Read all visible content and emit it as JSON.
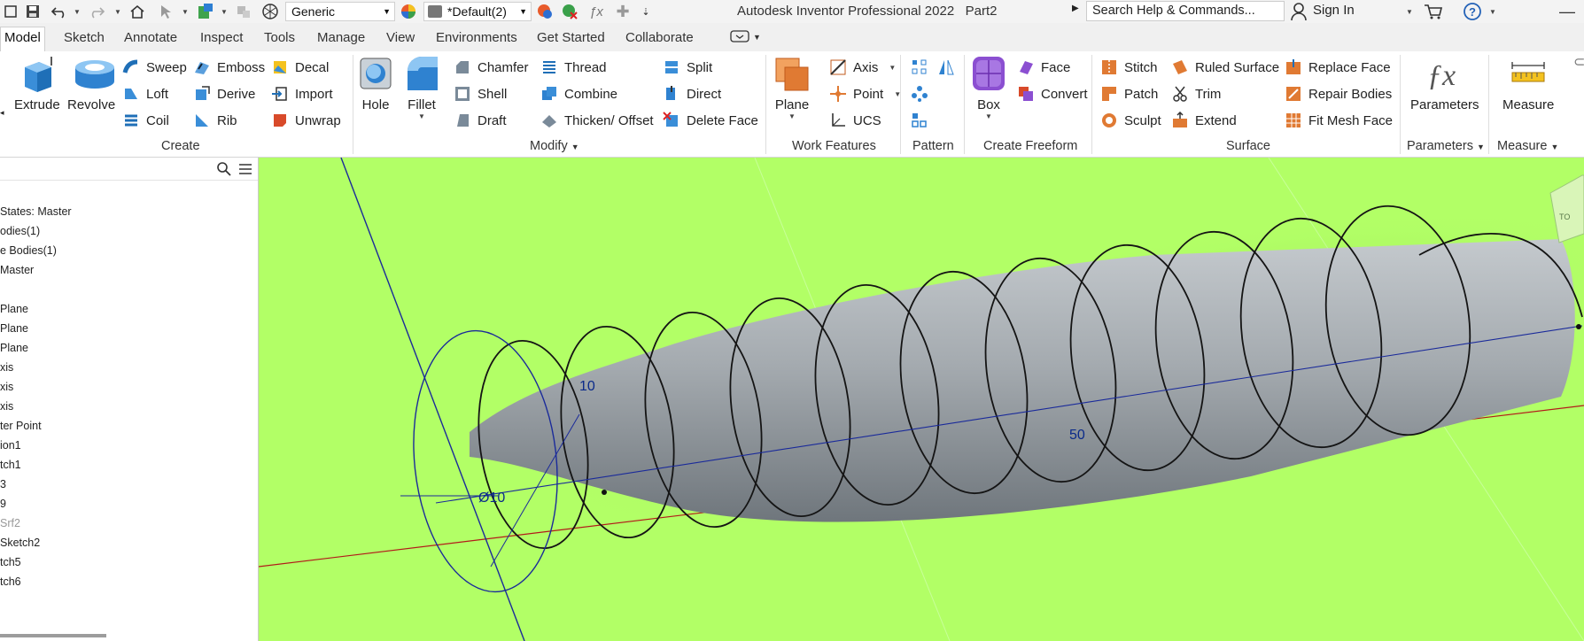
{
  "title_bar": {
    "material": "Generic",
    "appearance": "*Default(2)",
    "app_title": "Autodesk Inventor Professional 2022",
    "document": "Part2",
    "search_placeholder": "Search Help & Commands...",
    "sign_in": "Sign In"
  },
  "tabs": [
    "Model",
    "Sketch",
    "Annotate",
    "Inspect",
    "Tools",
    "Manage",
    "View",
    "Environments",
    "Get Started",
    "Collaborate"
  ],
  "ribbon": {
    "create": {
      "label": "Create",
      "extrude": "Extrude",
      "revolve": "Revolve",
      "sweep": "Sweep",
      "loft": "Loft",
      "coil": "Coil",
      "emboss": "Emboss",
      "derive": "Derive",
      "rib": "Rib",
      "decal": "Decal",
      "import": "Import",
      "unwrap": "Unwrap"
    },
    "modify": {
      "label": "Modify",
      "hole": "Hole",
      "fillet": "Fillet",
      "chamfer": "Chamfer",
      "shell": "Shell",
      "draft": "Draft",
      "thread": "Thread",
      "combine": "Combine",
      "thicken": "Thicken/ Offset",
      "split": "Split",
      "direct": "Direct",
      "delete_face": "Delete Face"
    },
    "work_features": {
      "label": "Work Features",
      "plane": "Plane",
      "axis": "Axis",
      "point": "Point",
      "ucs": "UCS"
    },
    "pattern": {
      "label": "Pattern"
    },
    "create_freeform": {
      "label": "Create Freeform",
      "box": "Box",
      "face": "Face",
      "convert": "Convert"
    },
    "surface": {
      "label": "Surface",
      "stitch": "Stitch",
      "patch": "Patch",
      "sculpt": "Sculpt",
      "ruled_surface": "Ruled Surface",
      "trim": "Trim",
      "extend": "Extend",
      "replace_face": "Replace Face",
      "repair_bodies": "Repair Bodies",
      "fit_mesh_face": "Fit Mesh Face"
    },
    "parameters": {
      "label": "Parameters",
      "button": "Parameters"
    },
    "measure": {
      "label": "Measure",
      "button": "Measure"
    }
  },
  "browser": {
    "items": [
      "States: Master",
      "odies(1)",
      "e Bodies(1)",
      "Master",
      "Plane",
      "Plane",
      "Plane",
      "xis",
      "xis",
      "xis",
      "ter Point",
      "ion1",
      "tch1",
      "3",
      "9",
      "Srf2",
      "Sketch2",
      "tch5",
      "tch6"
    ]
  },
  "viewport": {
    "background": "#b2ff66",
    "dim_pitch": "10",
    "dim_diameter": "Ø10",
    "dim_length": "50",
    "view_cube_label": "TO"
  },
  "colors": {
    "accent_blue": "#0a3b9a",
    "x_axis": "#b21a1a",
    "body": "#a2a8ad"
  }
}
